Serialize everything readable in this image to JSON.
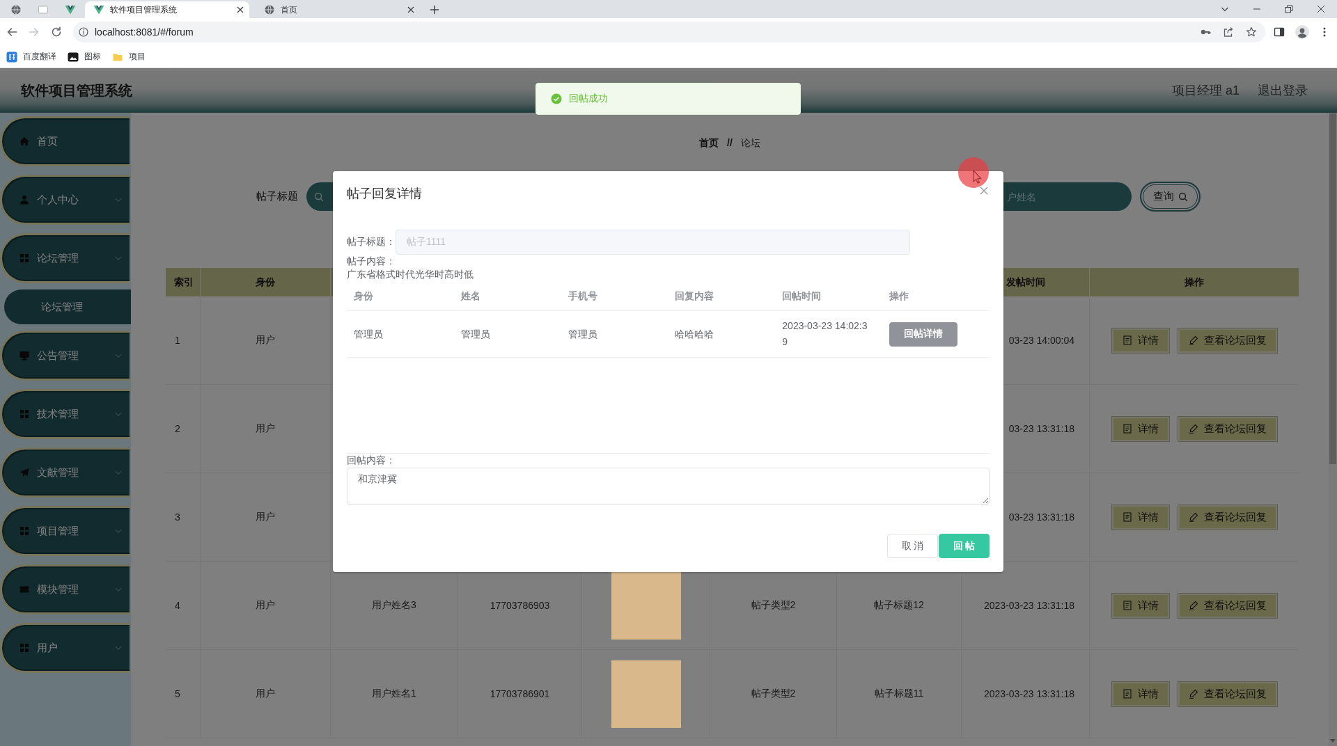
{
  "browser": {
    "tabs": [
      {
        "title": "软件项目管理系统",
        "selected": true
      },
      {
        "title": "首页",
        "selected": false
      }
    ],
    "nav_buttons": [
      {
        "kind": "back",
        "disabled": false
      },
      {
        "kind": "forward",
        "disabled": true
      },
      {
        "kind": "reload",
        "disabled": false
      }
    ],
    "url": "localhost:8081/#/forum",
    "bookmarks": [
      {
        "label": "百度翻译"
      },
      {
        "label": "图标"
      },
      {
        "label": "项目"
      }
    ]
  },
  "header": {
    "title": "软件项目管理系统",
    "user": "项目经理 a1",
    "logout": "退出登录"
  },
  "toast": {
    "kind": "success",
    "message": "回帖成功"
  },
  "sidebar": {
    "items": [
      {
        "label": "首页",
        "kind": "link"
      },
      {
        "label": "个人中心",
        "kind": "submenu"
      },
      {
        "label": "论坛管理",
        "kind": "submenu",
        "children": [
          {
            "label": "论坛管理"
          }
        ]
      },
      {
        "label": "公告管理",
        "kind": "submenu"
      },
      {
        "label": "技术管理",
        "kind": "submenu"
      },
      {
        "label": "文献管理",
        "kind": "submenu"
      },
      {
        "label": "项目管理",
        "kind": "submenu"
      },
      {
        "label": "模块管理",
        "kind": "submenu"
      },
      {
        "label": "用户",
        "kind": "submenu"
      }
    ]
  },
  "breadcrumb": {
    "items": [
      "首页",
      "论坛"
    ],
    "separator": "//"
  },
  "search": {
    "label": "帖子标题",
    "second_placeholder": "户姓名",
    "button": "查询"
  },
  "table": {
    "columns": {
      "column_1": "索引",
      "column_2": "身份",
      "column_8": "发帖时间",
      "column_9": "操作"
    },
    "rows": [
      {
        "column_1": "1",
        "column_2": "用户",
        "column_8": "03-23 14:00:04",
        "actions": [
          "详情",
          "查看论坛回复"
        ]
      },
      {
        "column_1": "2",
        "column_2": "用户",
        "column_8": "03-23 13:31:18",
        "actions": [
          "详情",
          "查看论坛回复"
        ]
      },
      {
        "column_1": "3",
        "column_2": "用户",
        "column_8": "03-23 13:31:18",
        "actions": [
          "详情",
          "查看论坛回复"
        ]
      },
      {
        "column_1": "4",
        "column_2": "用户",
        "column_3": "用户姓名3",
        "column_4": "17703786903",
        "photo": true,
        "column_6": "帖子类型2",
        "column_7": "帖子标题12",
        "column_8": "2023-03-23 13:31:18",
        "actions": [
          "详情",
          "查看论坛回复"
        ]
      },
      {
        "column_1": "5",
        "column_2": "用户",
        "column_3": "用户姓名1",
        "column_4": "17703786901",
        "photo": true,
        "column_6": "帖子类型2",
        "column_7": "帖子标题11",
        "column_8": "2023-03-23 13:31:18",
        "actions": [
          "详情",
          "查看论坛回复"
        ]
      }
    ]
  },
  "dialog": {
    "title": "帖子回复详情",
    "title_field": {
      "label": "帖子标题：",
      "value": "帖子1111",
      "disabled": true
    },
    "content_label": "帖子内容：",
    "content": "广东省格式时代光华时高时低",
    "replies": {
      "columns": [
        "身份",
        "姓名",
        "手机号",
        "回复内容",
        "回帖时间",
        "操作"
      ],
      "rows": [
        {
          "cells": [
            "管理员",
            "管理员",
            "管理员",
            "哈哈哈哈",
            "2023-03-23 14:02:39"
          ],
          "action": {
            "label": "回帖详情",
            "kind": "info"
          }
        }
      ]
    },
    "reply_field": {
      "label": "回帖内容：",
      "value": "和京津冀"
    },
    "buttons": [
      {
        "label": "取 消",
        "kind": "default"
      },
      {
        "label": "回 帖",
        "kind": "primary"
      }
    ]
  }
}
